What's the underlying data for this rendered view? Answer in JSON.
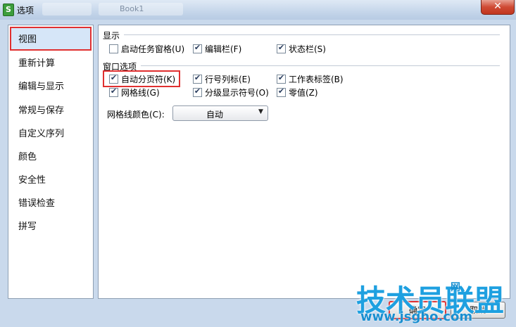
{
  "window": {
    "title": "选项",
    "app_icon_letter": "S",
    "close_glyph": "✕",
    "background_tab": "Book1"
  },
  "sidebar": {
    "items": [
      {
        "label": "视图",
        "selected": true
      },
      {
        "label": "重新计算"
      },
      {
        "label": "编辑与显示"
      },
      {
        "label": "常规与保存"
      },
      {
        "label": "自定义序列"
      },
      {
        "label": "颜色"
      },
      {
        "label": "安全性"
      },
      {
        "label": "错误检查"
      },
      {
        "label": "拼写"
      }
    ]
  },
  "display_group": {
    "title": "显示",
    "options": [
      {
        "label": "启动任务窗格(U)",
        "checked": false
      },
      {
        "label": "编辑栏(F)",
        "checked": true
      },
      {
        "label": "状态栏(S)",
        "checked": true
      }
    ]
  },
  "window_group": {
    "title": "窗口选项",
    "options": [
      {
        "label": "自动分页符(K)",
        "checked": true
      },
      {
        "label": "行号列标(E)",
        "checked": true
      },
      {
        "label": "工作表标签(B)",
        "checked": true
      },
      {
        "label": "网格线(G)",
        "checked": true
      },
      {
        "label": "分级显示符号(O)",
        "checked": true
      },
      {
        "label": "零值(Z)",
        "checked": true
      }
    ],
    "gridline_color": {
      "label": "网格线颜色(C):",
      "value": "自动"
    }
  },
  "buttons": {
    "ok": "确定",
    "cancel": "取消"
  },
  "watermark": {
    "main": "技术员联盟",
    "url": "www.jsgho.com",
    "small": "网"
  },
  "colors": {
    "highlight": "#e03030",
    "watermark": "#1ea0e0"
  }
}
